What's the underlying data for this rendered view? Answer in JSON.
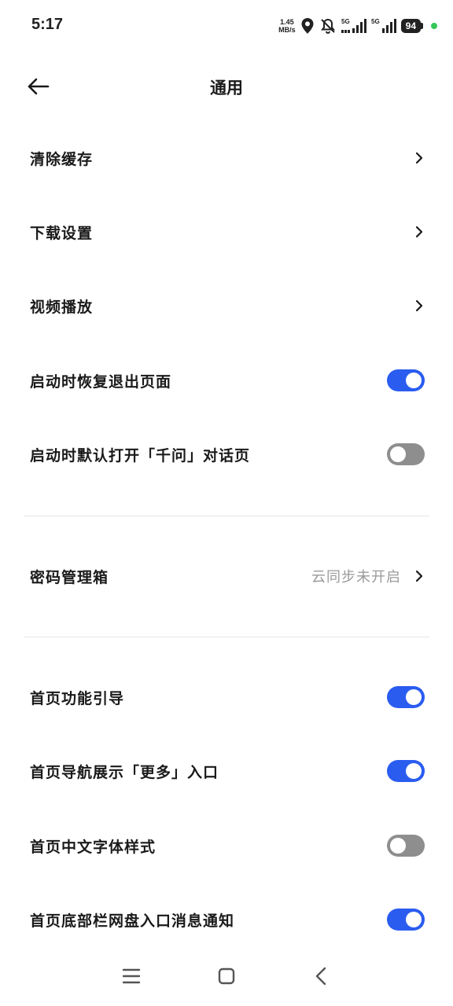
{
  "status_bar": {
    "time": "5:17",
    "net_speed_value": "1.45",
    "net_speed_unit": "MB/s",
    "network_1": "5G",
    "network_2": "5G",
    "battery": "94",
    "icons": [
      "location-icon",
      "mute-icon",
      "signal-icon",
      "battery-icon"
    ]
  },
  "header": {
    "title": "通用",
    "back_icon": "arrow-left-icon"
  },
  "rows": [
    {
      "label": "清除缓存",
      "type": "link"
    },
    {
      "label": "下载设置",
      "type": "link"
    },
    {
      "label": "视频播放",
      "type": "link"
    },
    {
      "label": "启动时恢复退出页面",
      "type": "toggle",
      "enabled": true
    },
    {
      "label": "启动时默认打开「千问」对话页",
      "type": "toggle",
      "enabled": false
    },
    {
      "label": "密码管理箱",
      "type": "link",
      "value": "云同步未开启"
    },
    {
      "label": "首页功能引导",
      "type": "toggle",
      "enabled": true
    },
    {
      "label": "首页导航展示「更多」入口",
      "type": "toggle",
      "enabled": true
    },
    {
      "label": "首页中文字体样式",
      "type": "toggle",
      "enabled": false
    },
    {
      "label": "首页底部栏网盘入口消息通知",
      "type": "toggle",
      "enabled": true
    }
  ],
  "nav_bar": {
    "icons": [
      "menu-icon",
      "home-icon",
      "back-icon"
    ]
  },
  "colors": {
    "toggle_on": "#2a5cf0",
    "toggle_off": "#8e8e8e",
    "divider": "#e6e6e6",
    "secondary_text": "#9a9a9a"
  }
}
